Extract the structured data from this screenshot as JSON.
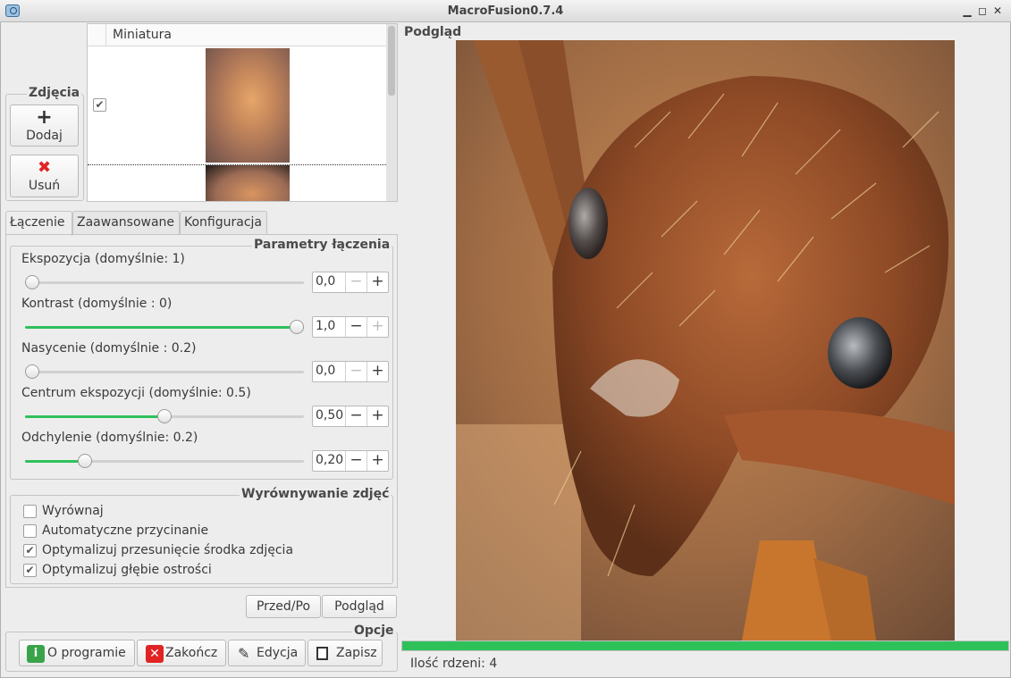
{
  "window": {
    "title": "MacroFusion0.7.4",
    "app_icon": "camera-icon"
  },
  "photos": {
    "group_title": "Zdjęcia",
    "add_label": "Dodaj",
    "remove_label": "Usuń",
    "list_header": "Miniatura",
    "items": [
      {
        "checked": true
      },
      {
        "checked": false
      }
    ]
  },
  "tabs": [
    "Łączenie",
    "Zaawansowane",
    "Konfiguracja"
  ],
  "params": {
    "group_title": "Parametry łączenia",
    "items": [
      {
        "label": "Ekspozycja (domyślnie: 1)",
        "value": "0,0",
        "fraction": 0.0,
        "minus_disabled": true,
        "plus_disabled": false
      },
      {
        "label": "Kontrast (domyślnie : 0)",
        "value": "1,0",
        "fraction": 1.0,
        "minus_disabled": false,
        "plus_disabled": true
      },
      {
        "label": "Nasycenie (domyślnie : 0.2)",
        "value": "0,0",
        "fraction": 0.0,
        "minus_disabled": true,
        "plus_disabled": false
      },
      {
        "label": "Centrum ekspozycji (domyślnie: 0.5)",
        "value": "0,50",
        "fraction": 0.5,
        "minus_disabled": false,
        "plus_disabled": false
      },
      {
        "label": "Odchylenie (domyślnie: 0.2)",
        "value": "0,20",
        "fraction": 0.2,
        "minus_disabled": false,
        "plus_disabled": false
      }
    ]
  },
  "align": {
    "group_title": "Wyrównywanie zdjęć",
    "items": [
      {
        "label": "Wyrównaj",
        "checked": false
      },
      {
        "label": "Automatyczne przycinanie",
        "checked": false
      },
      {
        "label": "Optymalizuj przesunięcie środka zdjęcia",
        "checked": true
      },
      {
        "label": "Optymalizuj głębie ostrości",
        "checked": true
      }
    ]
  },
  "compare": {
    "before_after": "Przed/Po",
    "preview": "Podgląd"
  },
  "options": {
    "group_title": "Opcje",
    "about": "O programie",
    "quit": "Zakończ",
    "edit": "Edycja",
    "save": "Zapisz"
  },
  "preview": {
    "label": "Podgląd",
    "progress": 1.0
  },
  "status": {
    "cores": "Ilość rdzeni: 4"
  },
  "colors": {
    "accent": "#2ec15a",
    "remove": "#e02424",
    "about": "#3aa34a"
  }
}
